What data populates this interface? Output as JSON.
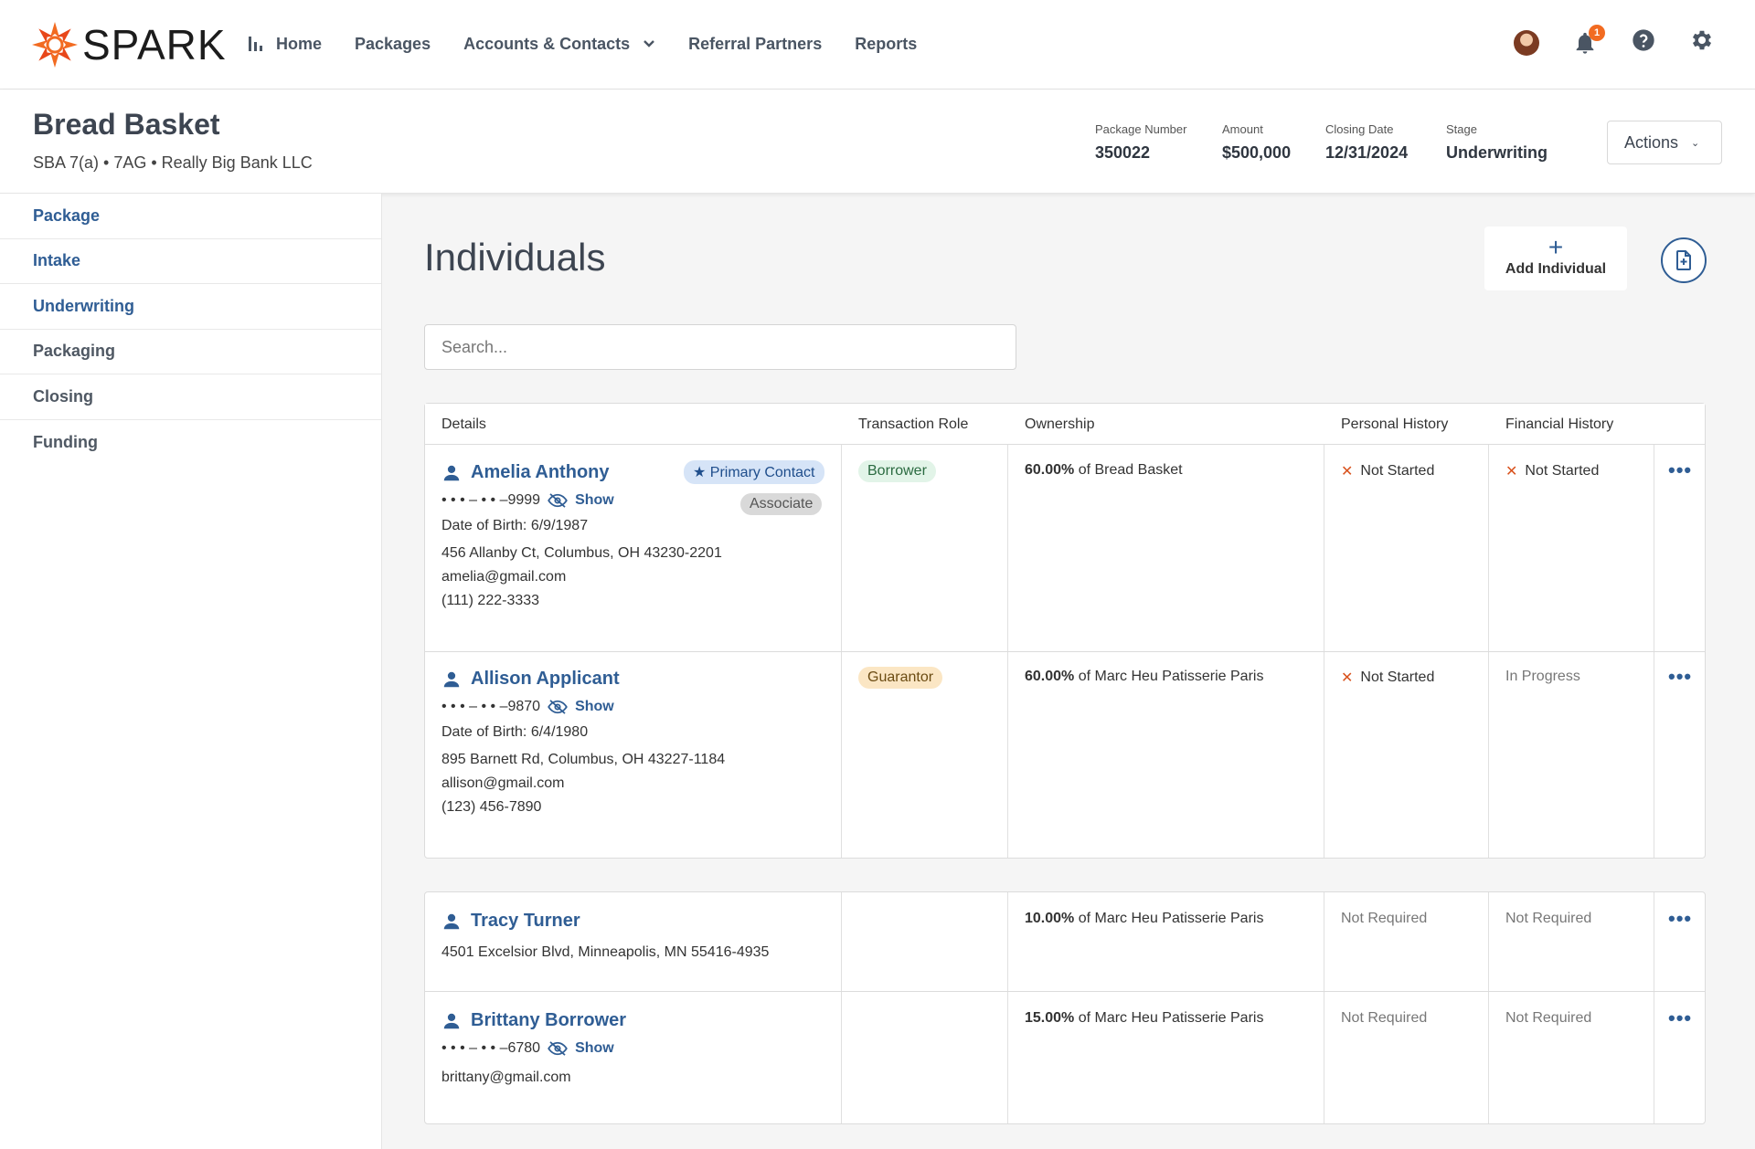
{
  "nav": {
    "logo_text": "SPARK",
    "items": [
      "Home",
      "Packages",
      "Accounts & Contacts",
      "Referral Partners",
      "Reports"
    ],
    "notification_count": "1"
  },
  "header": {
    "title": "Bread Basket",
    "subtitle": "SBA 7(a) • 7AG • Really Big Bank LLC",
    "meta": [
      {
        "label": "Package Number",
        "value": "350022"
      },
      {
        "label": "Amount",
        "value": "$500,000"
      },
      {
        "label": "Closing Date",
        "value": "12/31/2024"
      },
      {
        "label": "Stage",
        "value": "Underwriting"
      }
    ],
    "actions_label": "Actions"
  },
  "sidebar": {
    "items": [
      "Package",
      "Intake",
      "Underwriting",
      "Packaging",
      "Closing",
      "Funding"
    ]
  },
  "main": {
    "heading": "Individuals",
    "add_label": "Add Individual",
    "search_placeholder": "Search...",
    "columns": [
      "Details",
      "Transaction Role",
      "Ownership",
      "Personal History",
      "Financial History"
    ],
    "show_label": "Show",
    "rows": [
      {
        "name": "Amelia Anthony",
        "ssn": "• • • – • • –9999",
        "dob": "Date of Birth: 6/9/1987",
        "address": "456 Allanby Ct, Columbus, OH 43230-2201",
        "email": "amelia@gmail.com",
        "phone": "(111) 222-3333",
        "primary_badge": "Primary Contact",
        "assoc_badge": "Associate",
        "role": "Borrower",
        "own_pct": "60.00%",
        "own_of": " of Bread Basket",
        "personal": "Not Started",
        "financial": "Not Started"
      },
      {
        "name": "Allison Applicant",
        "ssn": "• • • – • • –9870",
        "dob": "Date of Birth: 6/4/1980",
        "address": "895 Barnett Rd, Columbus, OH 43227-1184",
        "email": "allison@gmail.com",
        "phone": "(123) 456-7890",
        "role": "Guarantor",
        "own_pct": "60.00%",
        "own_of": " of Marc Heu Patisserie Paris",
        "personal": "Not Started",
        "financial": "In Progress"
      },
      {
        "name": "Tracy Turner",
        "address": "4501 Excelsior Blvd, Minneapolis, MN 55416-4935",
        "own_pct": "10.00%",
        "own_of": " of Marc Heu Patisserie Paris",
        "personal": "Not Required",
        "financial": "Not Required"
      },
      {
        "name": "Brittany Borrower",
        "ssn": "• • • – • • –6780",
        "email": "brittany@gmail.com",
        "own_pct": "15.00%",
        "own_of": " of Marc Heu Patisserie Paris",
        "personal": "Not Required",
        "financial": "Not Required"
      }
    ]
  },
  "colors": {
    "primary_blue": "#2f5d94",
    "accent_orange": "#f26b21",
    "text_dark": "#3d4551"
  },
  "icons": [
    "spark-logo-icon",
    "bar-chart-icon",
    "chevron-down-icon",
    "avatar",
    "bell-icon",
    "help-icon",
    "gear-icon",
    "plus-icon",
    "document-add-icon",
    "person-icon",
    "eye-off-icon",
    "x-icon",
    "more-icon"
  ]
}
